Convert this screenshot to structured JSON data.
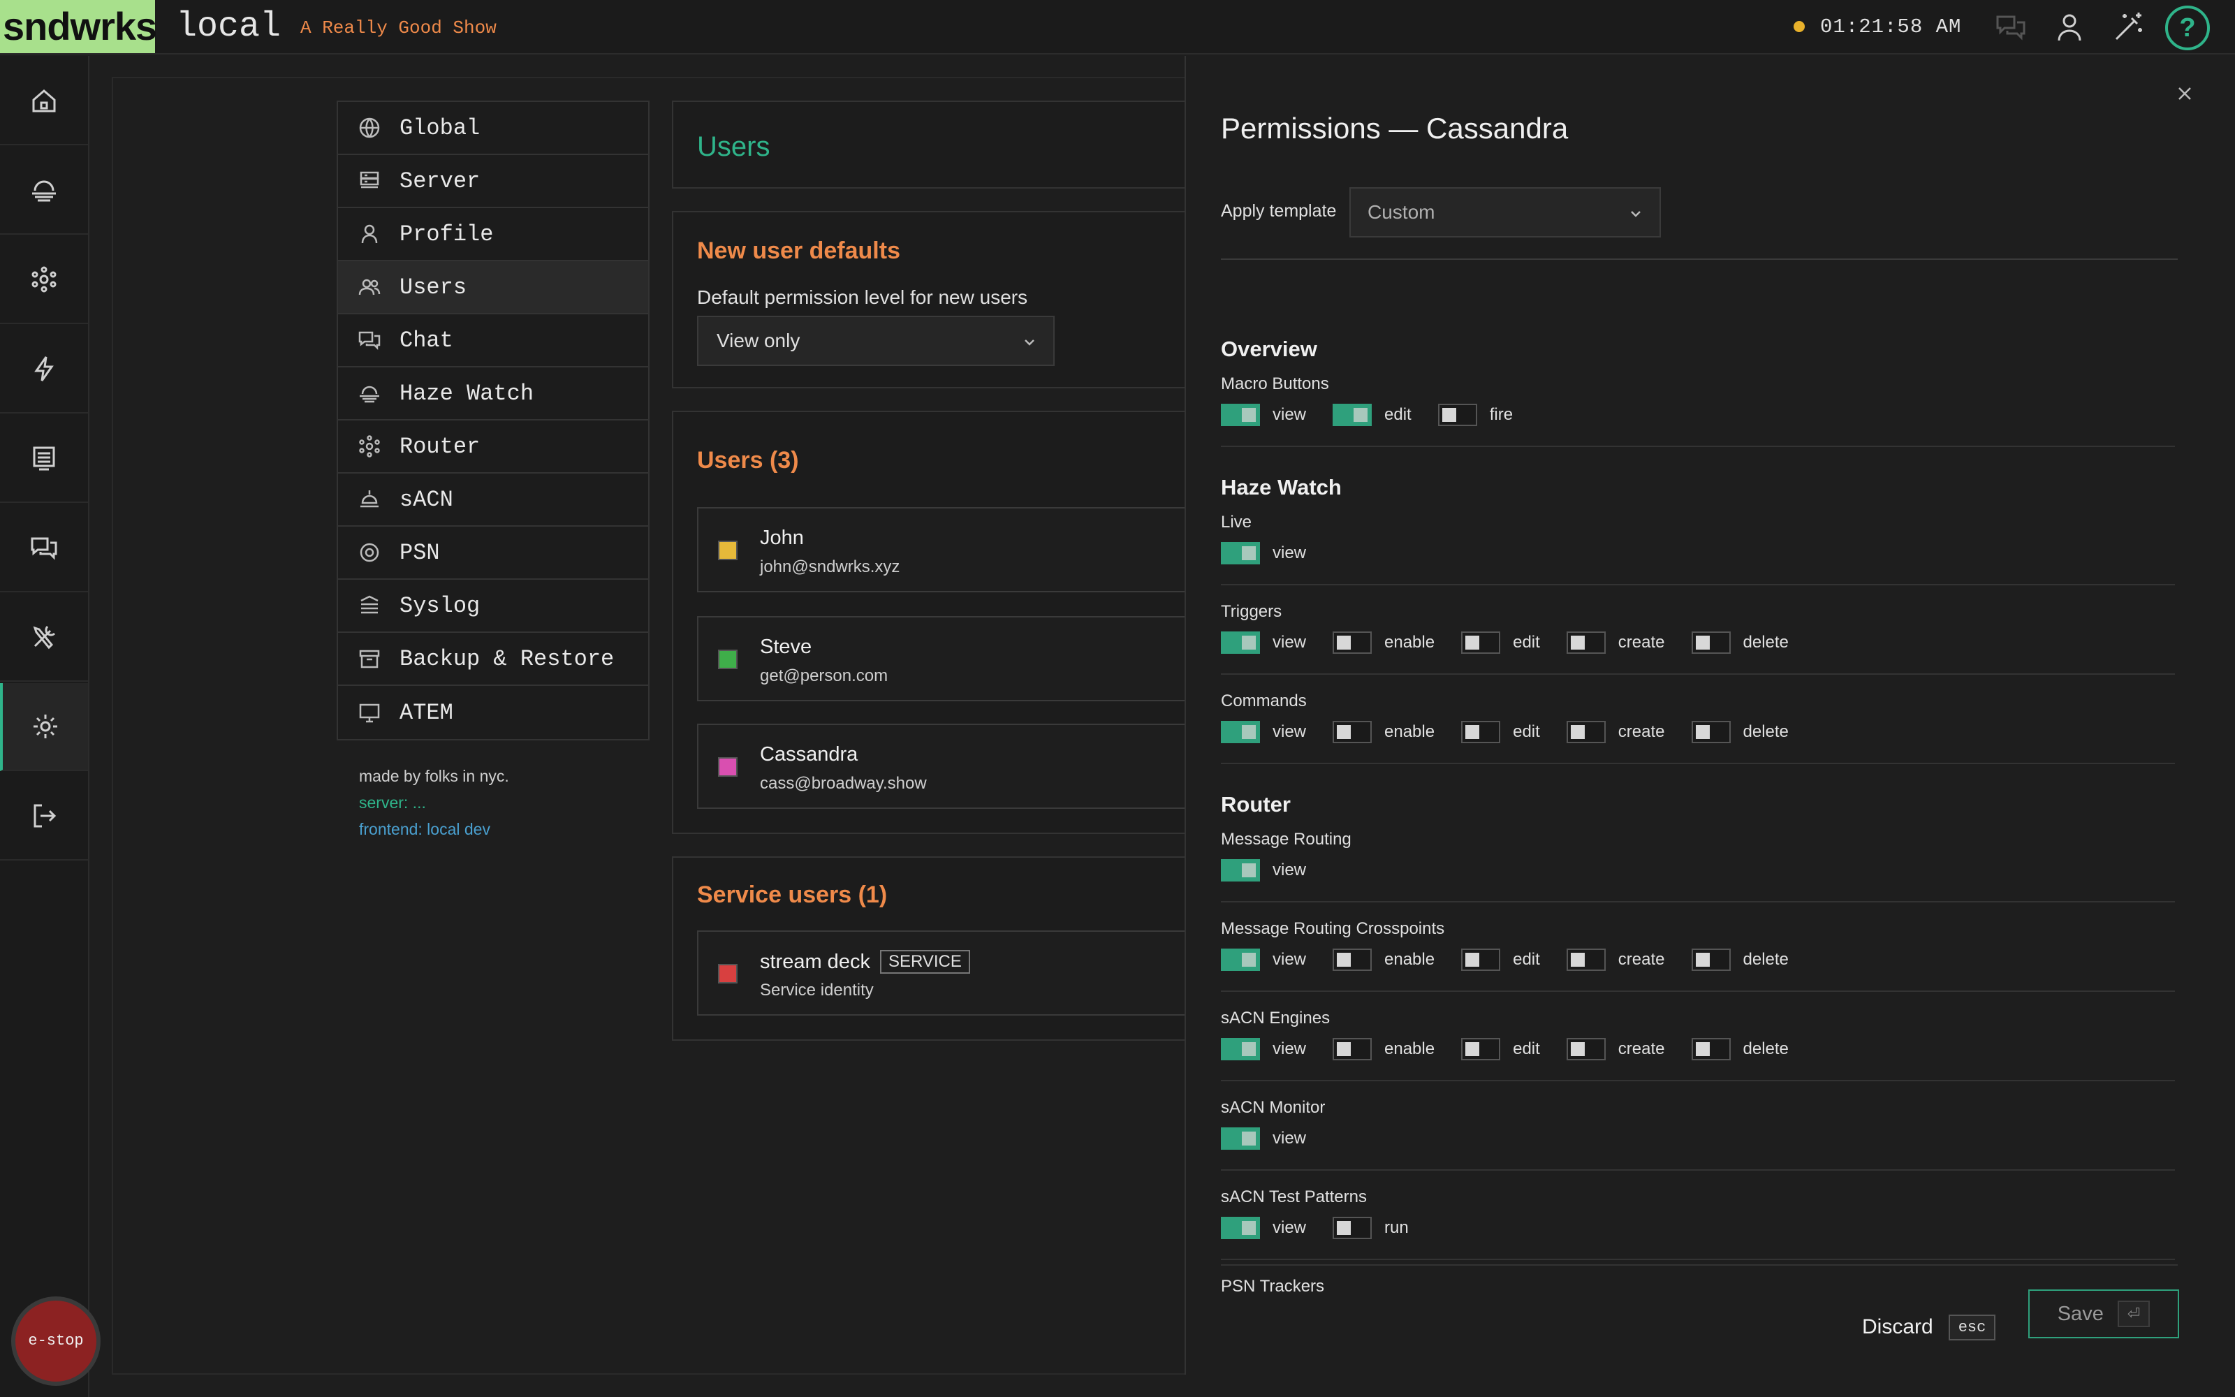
{
  "topbar": {
    "logo": "sndwrks",
    "env": "local",
    "show": "A Really Good Show",
    "clock": "01:21:58 AM",
    "help": "?"
  },
  "rail": {
    "items": [
      "home-icon",
      "haze-icon",
      "router-icon",
      "lightning-icon",
      "display-icon",
      "chat-icon",
      "tools-icon",
      "gear-icon",
      "logout-icon"
    ],
    "estop": "e-stop"
  },
  "settings_menu": {
    "items": [
      {
        "label": "Global",
        "icon": "globe-icon"
      },
      {
        "label": "Server",
        "icon": "server-icon"
      },
      {
        "label": "Profile",
        "icon": "person-icon"
      },
      {
        "label": "Users",
        "icon": "users-icon"
      },
      {
        "label": "Chat",
        "icon": "chat-icon"
      },
      {
        "label": "Haze Watch",
        "icon": "haze-icon"
      },
      {
        "label": "Router",
        "icon": "router-icon"
      },
      {
        "label": "sACN",
        "icon": "lamp-icon"
      },
      {
        "label": "PSN",
        "icon": "target-icon"
      },
      {
        "label": "Syslog",
        "icon": "syslog-icon"
      },
      {
        "label": "Backup & Restore",
        "icon": "archive-icon"
      },
      {
        "label": "ATEM",
        "icon": "monitor-icon"
      }
    ],
    "active": "Users"
  },
  "credits": {
    "line1": "made by folks in nyc.",
    "line2": "server: ...",
    "line3": "frontend: local dev"
  },
  "users_page": {
    "title": "Users",
    "defaults": {
      "title": "New user defaults",
      "label": "Default permission level for new users",
      "value": "View only"
    },
    "users": {
      "title": "Users (3)",
      "list": [
        {
          "name": "John",
          "email": "john@sndwrks.xyz",
          "color": "#e6b93a"
        },
        {
          "name": "Steve",
          "email": "get@person.com",
          "color": "#3fae4a"
        },
        {
          "name": "Cassandra",
          "email": "cass@broadway.show",
          "color": "#d94fb0"
        }
      ]
    },
    "service_users": {
      "title": "Service users (1)",
      "list": [
        {
          "name": "stream deck",
          "tag": "SERVICE",
          "subtitle": "Service identity",
          "color": "#d84040"
        }
      ]
    }
  },
  "drawer": {
    "title": "Permissions — Cassandra",
    "template_label": "Apply template",
    "template_value": "Custom",
    "sections": [
      {
        "title": "Overview",
        "groups": [
          {
            "label": "Macro Buttons",
            "perms": [
              {
                "name": "view",
                "on": true
              },
              {
                "name": "edit",
                "on": true
              },
              {
                "name": "fire",
                "on": false
              }
            ]
          }
        ]
      },
      {
        "title": "Haze Watch",
        "groups": [
          {
            "label": "Live",
            "perms": [
              {
                "name": "view",
                "on": true
              }
            ]
          },
          {
            "label": "Triggers",
            "perms": [
              {
                "name": "view",
                "on": true
              },
              {
                "name": "enable",
                "on": false
              },
              {
                "name": "edit",
                "on": false
              },
              {
                "name": "create",
                "on": false
              },
              {
                "name": "delete",
                "on": false
              }
            ]
          },
          {
            "label": "Commands",
            "perms": [
              {
                "name": "view",
                "on": true
              },
              {
                "name": "enable",
                "on": false
              },
              {
                "name": "edit",
                "on": false
              },
              {
                "name": "create",
                "on": false
              },
              {
                "name": "delete",
                "on": false
              }
            ]
          }
        ]
      },
      {
        "title": "Router",
        "groups": [
          {
            "label": "Message Routing",
            "perms": [
              {
                "name": "view",
                "on": true
              }
            ]
          },
          {
            "label": "Message Routing Crosspoints",
            "perms": [
              {
                "name": "view",
                "on": true
              },
              {
                "name": "enable",
                "on": false
              },
              {
                "name": "edit",
                "on": false
              },
              {
                "name": "create",
                "on": false
              },
              {
                "name": "delete",
                "on": false
              }
            ]
          },
          {
            "label": "sACN Engines",
            "perms": [
              {
                "name": "view",
                "on": true
              },
              {
                "name": "enable",
                "on": false
              },
              {
                "name": "edit",
                "on": false
              },
              {
                "name": "create",
                "on": false
              },
              {
                "name": "delete",
                "on": false
              }
            ]
          },
          {
            "label": "sACN Monitor",
            "perms": [
              {
                "name": "view",
                "on": true
              }
            ]
          },
          {
            "label": "sACN Test Patterns",
            "perms": [
              {
                "name": "view",
                "on": true
              },
              {
                "name": "run",
                "on": false
              }
            ]
          },
          {
            "label": "PSN Trackers",
            "perms": []
          }
        ]
      }
    ],
    "discard_label": "Discard",
    "discard_key": "esc",
    "save_label": "Save",
    "save_key": "⏎"
  }
}
